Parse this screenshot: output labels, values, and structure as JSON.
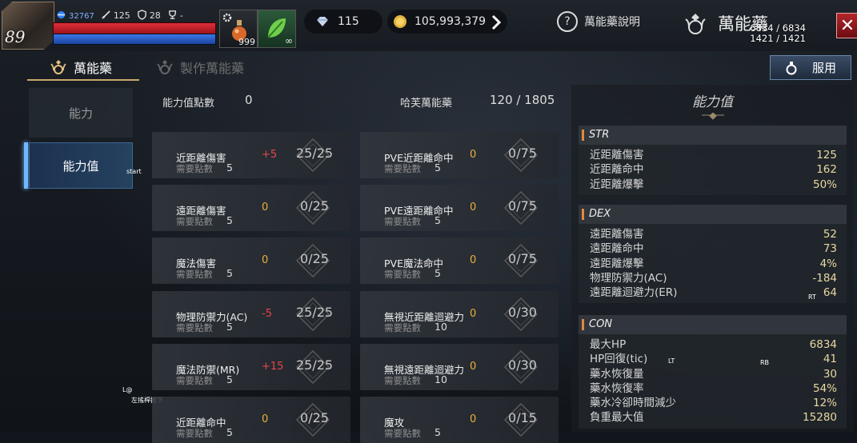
{
  "player": {
    "level": "89",
    "power": "32767",
    "attack": "125",
    "defense": "28",
    "trophy": "-",
    "hp_text": "6834 / 6834",
    "mp_text": "1421 / 1421",
    "hp_fraction": 1.0,
    "mp_fraction": 1.0
  },
  "items": {
    "potion_count": "999"
  },
  "currency": {
    "diamonds": "115",
    "gold": "105,993,379"
  },
  "header": {
    "help_label": "萬能藥說明",
    "title": "萬能藥",
    "close_label": "✕"
  },
  "tabs": [
    {
      "label": "萬能藥",
      "active": true
    },
    {
      "label": "製作萬能藥",
      "active": false
    }
  ],
  "use_button": {
    "label": "服用"
  },
  "side_menu": [
    {
      "label": "能力",
      "active": false
    },
    {
      "label": "能力值",
      "active": true
    }
  ],
  "overlay_text": {
    "start": "start",
    "lb": "L@",
    "stick_hint": "左搖桿按下",
    "rt": "RT",
    "lt": "LT",
    "rb": "RB"
  },
  "summary": {
    "points_label": "能力值點數",
    "points_value": "0",
    "elixir_label": "哈芙萬能藥",
    "elixir_value": "120 / 1805"
  },
  "need_label": "需要點數",
  "cells_left": [
    {
      "name": "近距離傷害",
      "delta": "+5",
      "delta_color": "#e8454a",
      "value": "25/25",
      "need": "5"
    },
    {
      "name": "遠距離傷害",
      "delta": "0",
      "delta_color": "#e8b03c",
      "value": "0/25",
      "need": "5"
    },
    {
      "name": "魔法傷害",
      "delta": "0",
      "delta_color": "#e8b03c",
      "value": "0/25",
      "need": "5"
    },
    {
      "name": "物理防禦力(AC)",
      "delta": "-5",
      "delta_color": "#e8454a",
      "value": "25/25",
      "need": "5"
    },
    {
      "name": "魔法防禦(MR)",
      "delta": "+15",
      "delta_color": "#e8454a",
      "value": "25/25",
      "need": "5"
    },
    {
      "name": "近距離命中",
      "delta": "0",
      "delta_color": "#e8b03c",
      "value": "0/25",
      "need": "5"
    }
  ],
  "cells_right": [
    {
      "name": "PVE近距離命中",
      "delta": "0",
      "delta_color": "#e8b03c",
      "value": "0/75",
      "need": "5"
    },
    {
      "name": "PVE遠距離命中",
      "delta": "0",
      "delta_color": "#e8b03c",
      "value": "0/75",
      "need": "5"
    },
    {
      "name": "PVE魔法命中",
      "delta": "0",
      "delta_color": "#e8b03c",
      "value": "0/75",
      "need": "5"
    },
    {
      "name": "無視近距離迴避力",
      "delta": "0",
      "delta_color": "#e8b03c",
      "value": "0/30",
      "need": "10"
    },
    {
      "name": "無視遠距離迴避力",
      "delta": "0",
      "delta_color": "#e8b03c",
      "value": "0/30",
      "need": "10"
    },
    {
      "name": "魔攻",
      "delta": "0",
      "delta_color": "#e8b03c",
      "value": "0/15",
      "need": "5"
    }
  ],
  "panel": {
    "title": "能力值",
    "groups": [
      {
        "name": "STR",
        "rows": [
          {
            "label": "近距離傷害",
            "value": "125"
          },
          {
            "label": "近距離命中",
            "value": "162"
          },
          {
            "label": "近距離爆擊",
            "value": "50%"
          }
        ]
      },
      {
        "name": "DEX",
        "rows": [
          {
            "label": "遠距離傷害",
            "value": "52"
          },
          {
            "label": "遠距離命中",
            "value": "73"
          },
          {
            "label": "遠距離爆擊",
            "value": "4%"
          },
          {
            "label": "物理防禦力(AC)",
            "value": "-184"
          },
          {
            "label": "遠距離迴避力(ER)",
            "value": "64"
          }
        ]
      },
      {
        "name": "CON",
        "rows": [
          {
            "label": "最大HP",
            "value": "6834"
          },
          {
            "label": "HP回復(tic)",
            "value": "41"
          },
          {
            "label": "藥水恢復量",
            "value": "30"
          },
          {
            "label": "藥水恢復率",
            "value": "54%"
          },
          {
            "label": "藥水冷卻時間減少",
            "value": "12%"
          },
          {
            "label": "負重最大值",
            "value": "15280"
          }
        ]
      }
    ]
  }
}
